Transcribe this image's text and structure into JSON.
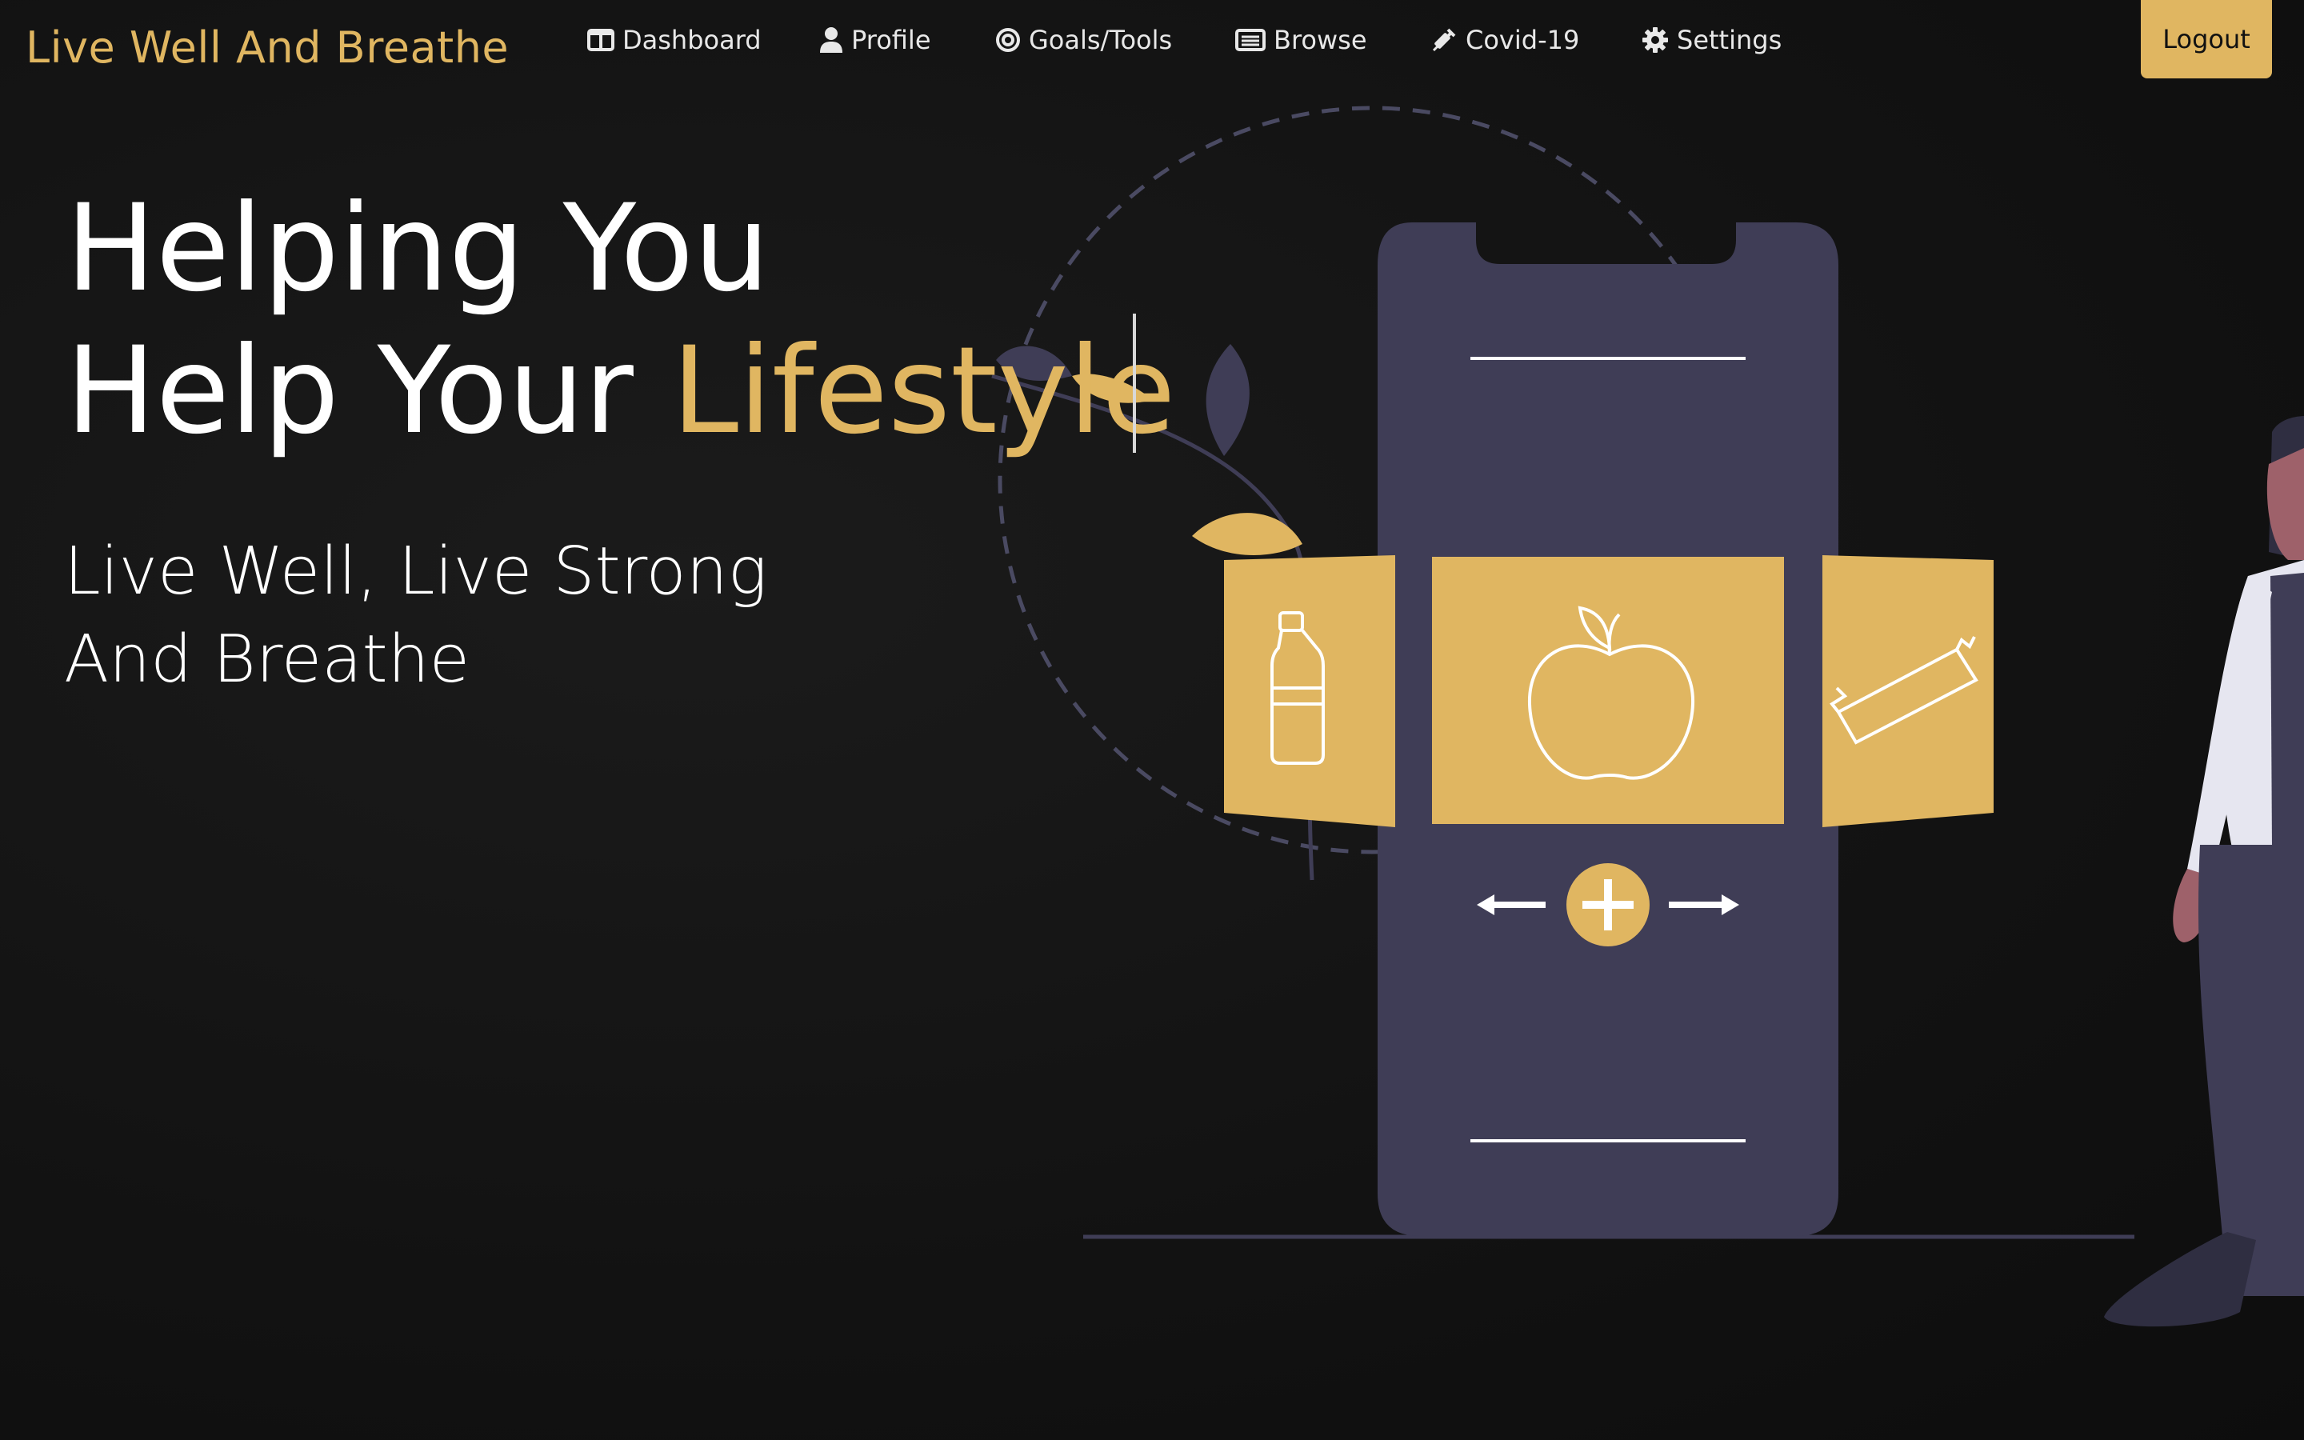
{
  "brand": {
    "name": "Live Well And Breathe"
  },
  "nav": {
    "items": [
      {
        "label": "Dashboard",
        "icon": "dashboard-icon"
      },
      {
        "label": "Profile",
        "icon": "user-icon"
      },
      {
        "label": "Goals/Tools",
        "icon": "target-icon"
      },
      {
        "label": "Browse",
        "icon": "list-icon"
      },
      {
        "label": "Covid-19",
        "icon": "syringe-icon"
      },
      {
        "label": "Settings",
        "icon": "gear-icon"
      }
    ],
    "logout_label": "Logout"
  },
  "hero": {
    "line1": "Helping You",
    "line2_prefix": "Help Your ",
    "line2_accent": "Lifestyle",
    "subtitle_line1": "Live Well, Live Strong",
    "subtitle_line2": "And Breathe"
  },
  "colors": {
    "accent": "#e0b661",
    "background": "#111111",
    "phone": "#3f3d56",
    "text": "#ffffff"
  }
}
